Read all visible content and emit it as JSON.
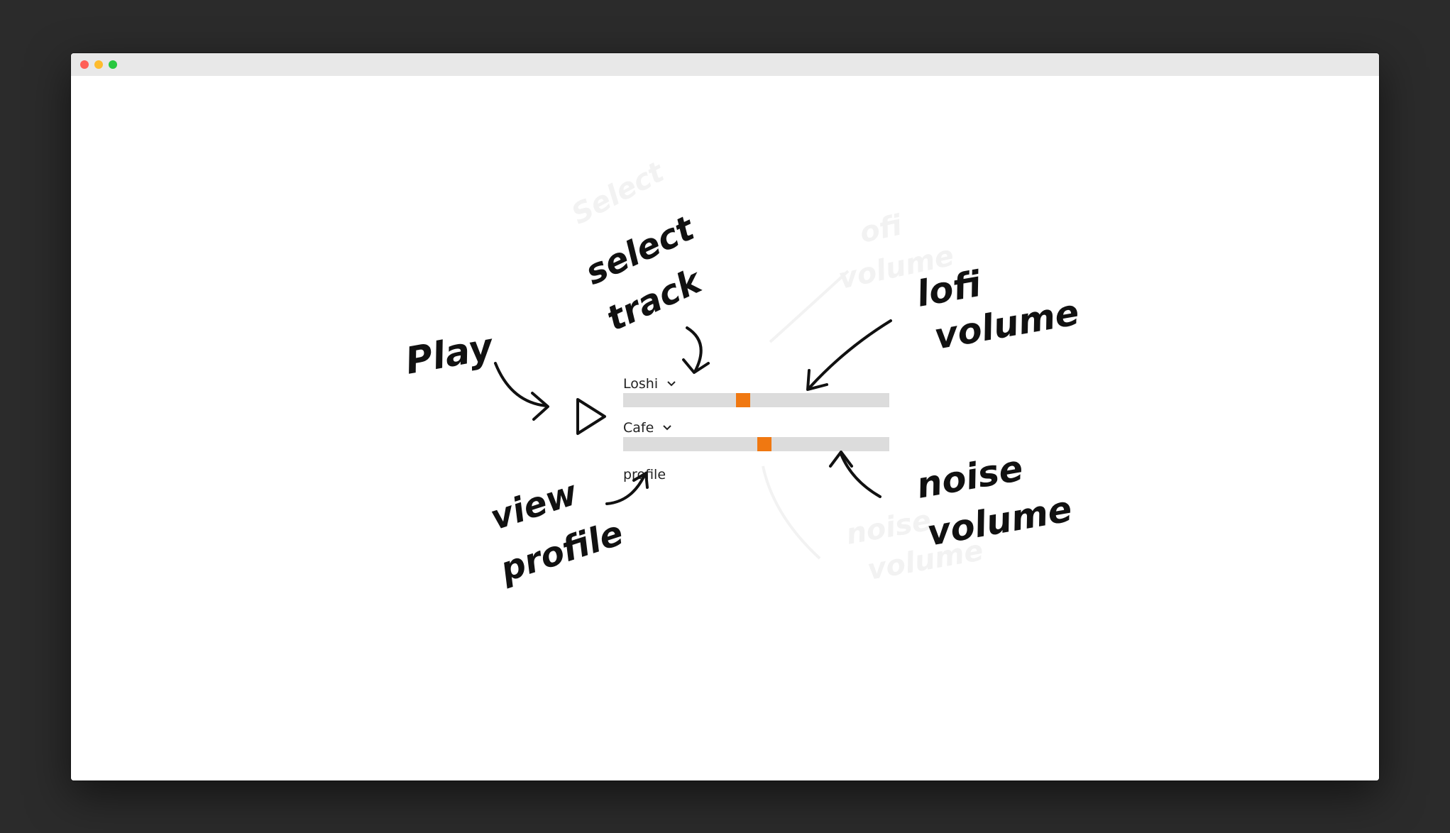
{
  "player": {
    "lofi_track": "Loshi",
    "lofi_volume_fraction": 0.45,
    "noise_track": "Cafe",
    "noise_volume_fraction": 0.53,
    "profile_label": "profile",
    "accent_color": "#f07811",
    "track_color": "#dcdcdc"
  },
  "annotations": {
    "play": "Play",
    "select_track_1": "select",
    "select_track_2": "track",
    "lofi_volume_1": "lofi",
    "lofi_volume_2": "volume",
    "view_profile_1": "view",
    "view_profile_2": "profile",
    "noise_volume_1": "noise",
    "noise_volume_2": "volume"
  },
  "icons": {
    "play": "play-triangle-icon",
    "dropdown": "chevron-down-icon",
    "window_controls": [
      "close-dot",
      "minimize-dot",
      "maximize-dot"
    ]
  }
}
